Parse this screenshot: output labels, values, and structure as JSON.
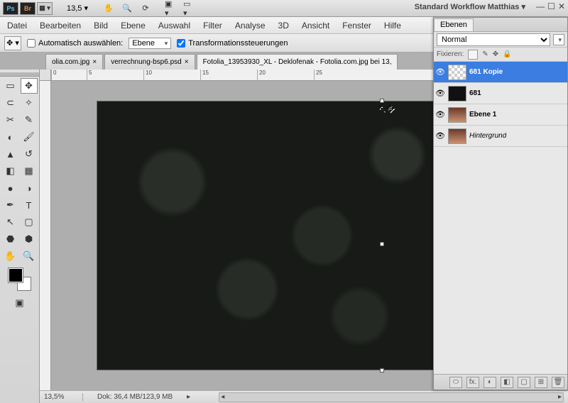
{
  "top": {
    "zoom": "13,5",
    "workflow": "Standard Workflow Matthias ▾"
  },
  "menu": [
    "Datei",
    "Bearbeiten",
    "Bild",
    "Ebene",
    "Auswahl",
    "Filter",
    "Analyse",
    "3D",
    "Ansicht",
    "Fenster",
    "Hilfe"
  ],
  "options": {
    "auto_select": "Automatisch auswählen:",
    "target": "Ebene",
    "transform_controls": "Transformationssteuerungen"
  },
  "tabs": [
    {
      "label": "olia.com.jpg",
      "active": false,
      "closable": true
    },
    {
      "label": "verrechnung-bsp6.psd",
      "active": false,
      "closable": true
    },
    {
      "label": "Fotolia_13953930_XL - Deklofenak - Fotolia.com.jpg bei 13,",
      "active": true,
      "closable": false
    }
  ],
  "ruler_ticks": [
    "0",
    "5",
    "10",
    "15",
    "20",
    "25"
  ],
  "status": {
    "zoom": "13,5%",
    "doc": "Dok: 36,4 MB/123,9 MB"
  },
  "layers_panel": {
    "title": "Ebenen",
    "blend_mode": "Normal",
    "lock_label": "Fixieren:",
    "layers": [
      {
        "name": "681 Kopie",
        "selected": true,
        "thumb": "checker",
        "bold": true
      },
      {
        "name": "681",
        "selected": false,
        "thumb": "dark",
        "bold": true
      },
      {
        "name": "Ebene 1",
        "selected": false,
        "thumb": "face",
        "bold": true
      },
      {
        "name": "Hintergrund",
        "selected": false,
        "thumb": "face",
        "italic": true
      }
    ],
    "footer_icons": [
      "⬭",
      "fx.",
      "◐",
      "◧",
      "▢",
      "⊞",
      "🗑"
    ]
  }
}
